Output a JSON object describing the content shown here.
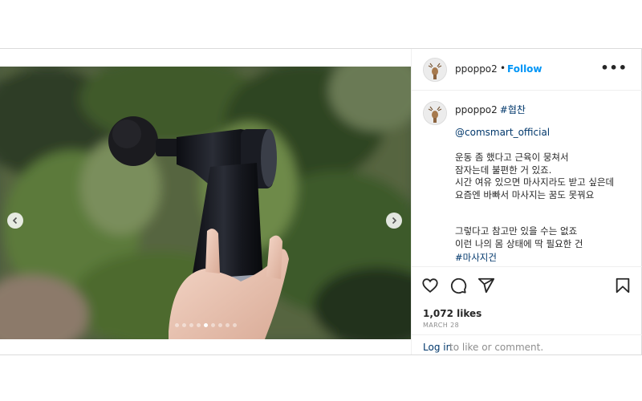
{
  "post": {
    "carousel": {
      "slide_count": 9,
      "active_index": 4,
      "image_description_icon": "massage-gun-photo"
    },
    "header": {
      "username": "ppoppo2",
      "separator": "•",
      "follow_label": "Follow",
      "more_icon": "more-horizontal-icon"
    },
    "caption": {
      "username": "ppoppo2",
      "tag": "#협찬",
      "mention": "@comsmart_official",
      "paragraph1": "운동 좀 했다고 근육이 뭉쳐서\n잠자는데 불편한 거 있죠.\n시간 여유 있으면 마사지라도 받고 싶은데\n요즘엔 바빠서 마사지는 꿈도 못꿔요",
      "paragraph2": "그렇다고 참고만 있을 수는 없죠\n이런 나의 몸 상태에 딱 필요한 건",
      "hashtag": "#마사지건"
    },
    "actions": {
      "like_icon": "heart-icon",
      "comment_icon": "comment-icon",
      "share_icon": "share-icon",
      "save_icon": "bookmark-icon"
    },
    "likes": "1,072 likes",
    "date": "MARCH 28",
    "login": {
      "link": "Log in",
      "rest": " to like or comment."
    }
  },
  "colors": {
    "accent": "#0095f6",
    "link": "#00376b",
    "muted": "#8e8e8e",
    "border": "#dbdbdb"
  }
}
